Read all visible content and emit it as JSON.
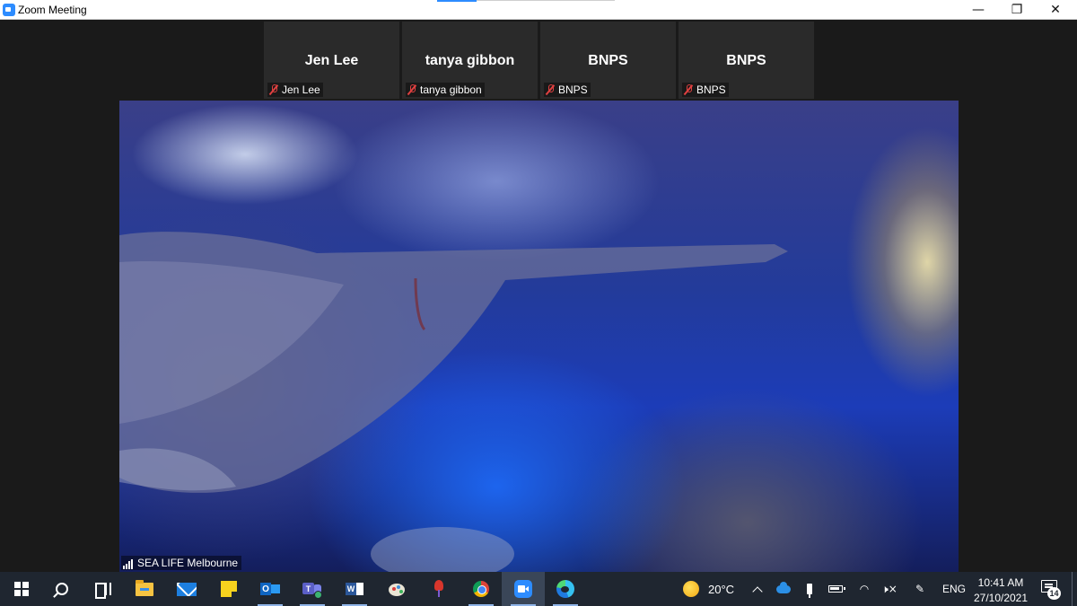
{
  "window": {
    "title": "Zoom Meeting",
    "minimize_glyph": "—",
    "restore_glyph": "❐",
    "close_glyph": "✕"
  },
  "gallery": [
    {
      "display_name": "Jen Lee",
      "tag": "Jen Lee",
      "mic": "muted"
    },
    {
      "display_name": "tanya gibbon",
      "tag": "tanya gibbon",
      "mic": "muted"
    },
    {
      "display_name": "BNPS",
      "tag": "BNPS",
      "mic": "muted"
    },
    {
      "display_name": "BNPS",
      "tag": "BNPS",
      "mic": "muted"
    }
  ],
  "active_video": {
    "name": "SEA LIFE Melbourne",
    "signal_icon": "signal-strength-icon"
  },
  "taskbar": {
    "apps": [
      {
        "name": "start",
        "icon": "windows-logo-icon"
      },
      {
        "name": "search",
        "icon": "search-icon"
      },
      {
        "name": "task-view",
        "icon": "task-view-icon"
      },
      {
        "name": "file-explorer",
        "icon": "folder-icon"
      },
      {
        "name": "mail",
        "icon": "mail-icon"
      },
      {
        "name": "sticky-notes",
        "icon": "sticky-notes-icon"
      },
      {
        "name": "outlook",
        "icon": "outlook-icon",
        "letter": "O"
      },
      {
        "name": "teams",
        "icon": "teams-icon",
        "letter": "T"
      },
      {
        "name": "word",
        "icon": "word-icon",
        "letter": "W"
      },
      {
        "name": "paint",
        "icon": "paint-icon"
      },
      {
        "name": "pinned-app",
        "icon": "pin-icon"
      },
      {
        "name": "chrome",
        "icon": "chrome-icon"
      },
      {
        "name": "zoom",
        "icon": "zoom-icon"
      },
      {
        "name": "edge",
        "icon": "edge-icon"
      }
    ],
    "weather": {
      "temperature": "20°C",
      "icon": "sun-icon"
    },
    "tray": {
      "mute_glyph": "🕨×",
      "pen_glyph": "✎",
      "wifi_glyph": "◠",
      "language": "ENG",
      "time": "10:41 AM",
      "date": "27/10/2021",
      "notification_count": "14"
    }
  },
  "colors": {
    "zoom_blue": "#2d8cff",
    "muted_red": "#e04040",
    "taskbar_bg": "#1f2630",
    "meeting_bg": "#1a1a1a"
  }
}
